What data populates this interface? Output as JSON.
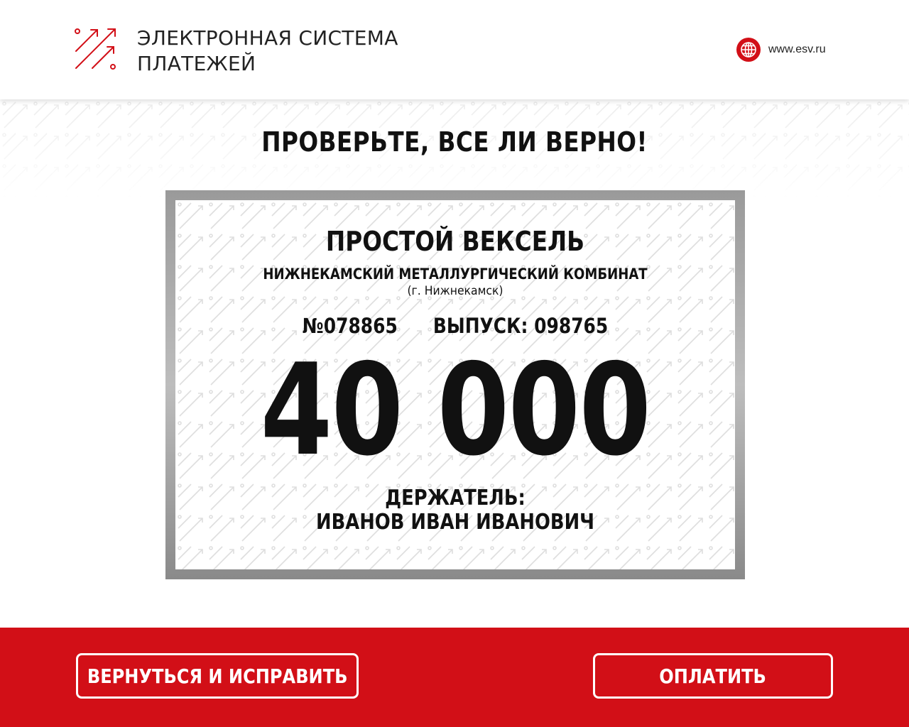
{
  "header": {
    "brand_line1": "ЭЛЕКТРОННАЯ СИСТЕМА",
    "brand_line2": "ПЛАТЕЖЕЙ",
    "site_url": "www.esv.ru",
    "logo_icon": "arrows-logo-icon",
    "globe_icon": "globe-icon"
  },
  "main": {
    "title": "ПРОВЕРЬТЕ, ВСЕ ЛИ ВЕРНО!"
  },
  "bill": {
    "title": "ПРОСТОЙ ВЕКСЕЛЬ",
    "issuer": "НИЖНЕКАМСКИЙ МЕТАЛЛУРГИЧЕСКИЙ КОМБИНАТ",
    "city": "(г. Нижнекамск)",
    "number": "№078865",
    "issue": "ВЫПУСК: 098765",
    "amount": "40 000",
    "holder_label": "ДЕРЖАТЕЛЬ:",
    "holder_name": "ИВАНОВ ИВАН ИВАНОВИЧ"
  },
  "footer": {
    "back_label": "ВЕРНУТЬСЯ И ИСПРАВИТЬ",
    "pay_label": "ОПЛАТИТЬ"
  },
  "colors": {
    "accent": "#d20f17",
    "text": "#111111",
    "frame": "#9a9a9a"
  }
}
